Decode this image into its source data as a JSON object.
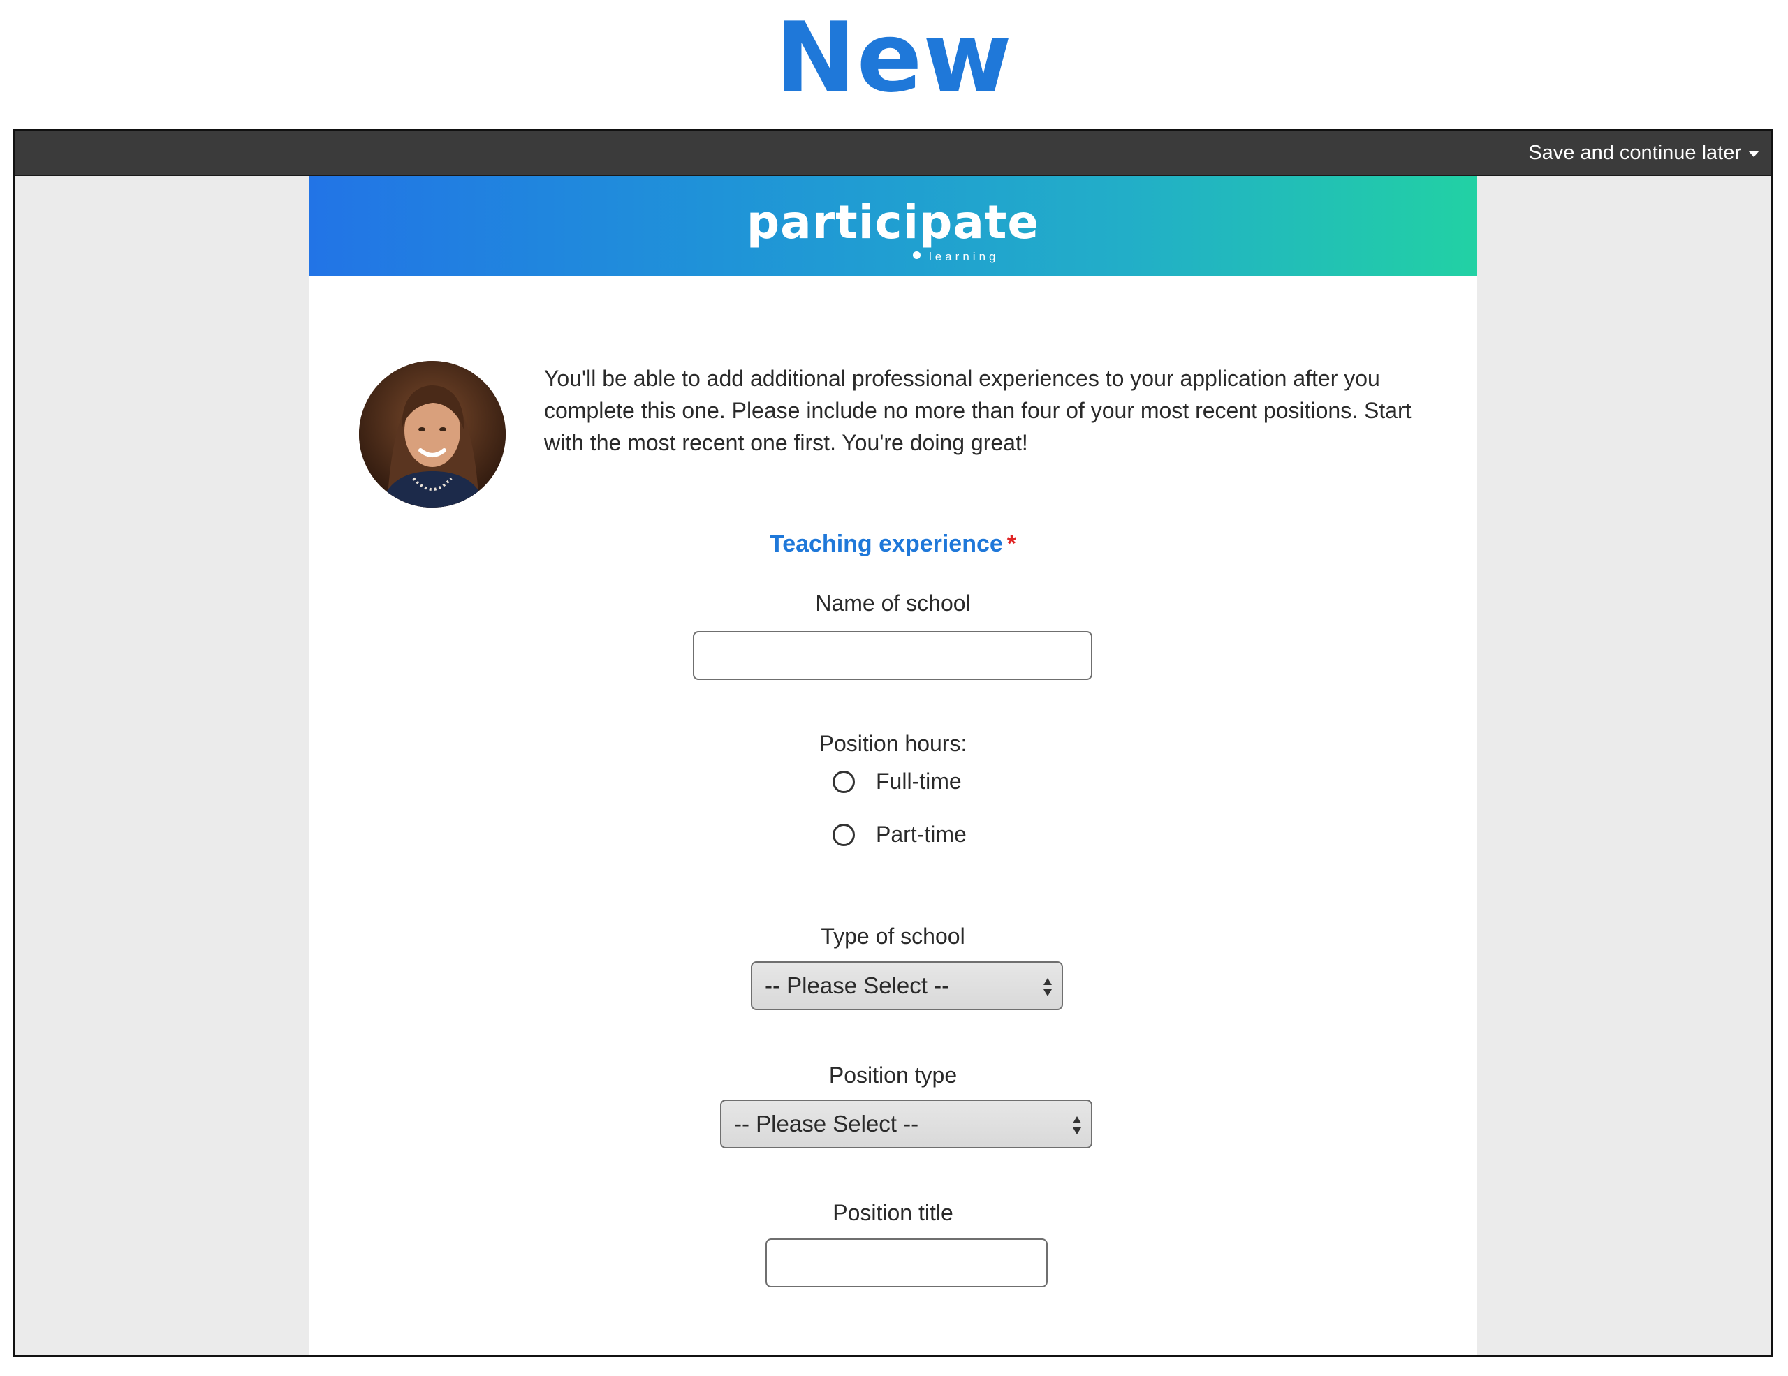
{
  "heading": "New",
  "toolbar": {
    "save_later_label": "Save and continue later"
  },
  "banner": {
    "logo_text": "participate",
    "logo_subtext": "learning"
  },
  "intro": {
    "text": "You'll be able to add additional professional experiences to your application after you complete this one. Please include no more than four of your most recent positions. Start with the most recent one first. You're doing great!"
  },
  "form": {
    "section_title": "Teaching experience",
    "required_mark": "*",
    "school_name_label": "Name of school",
    "school_name_value": "",
    "position_hours_label": "Position hours:",
    "hours_options": [
      "Full-time",
      "Part-time"
    ],
    "school_type_label": "Type of school",
    "school_type_value": "-- Please Select --",
    "position_type_label": "Position type",
    "position_type_value": "-- Please Select --",
    "position_title_label": "Position title",
    "position_title_value": ""
  },
  "colors": {
    "accent": "#1f78d9",
    "required": "#e02424",
    "topbar": "#3b3b3b"
  },
  "icons": {
    "dropdown": "caret-down-icon",
    "select": "select-arrows-icon"
  }
}
